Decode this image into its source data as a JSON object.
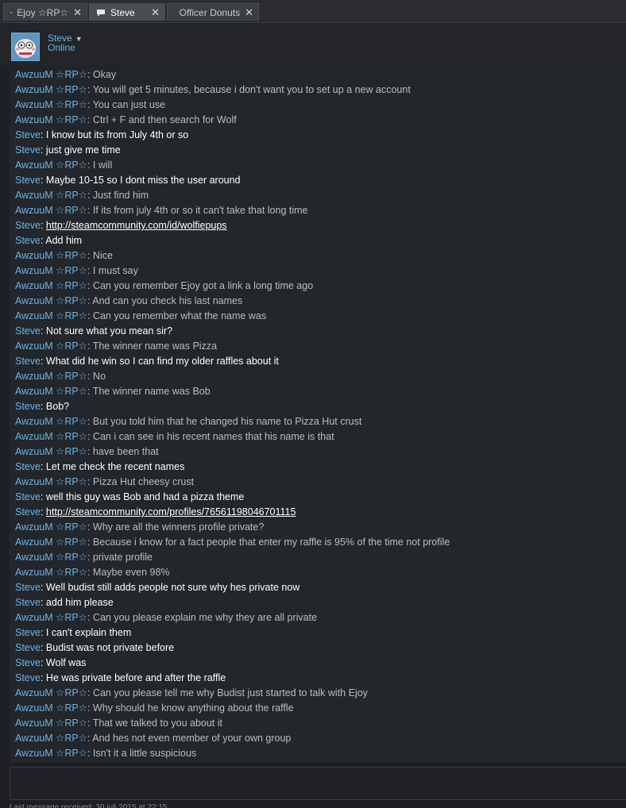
{
  "tabs": [
    {
      "label": "Ejoy ☆RP☆",
      "close": "✕"
    },
    {
      "label": "Steve",
      "close": "✕"
    },
    {
      "label": "Officer Donuts",
      "close": "✕"
    }
  ],
  "friend": {
    "name": "Steve",
    "status": "Online",
    "caret": "▼"
  },
  "messages": [
    {
      "speaker": "AwzuuM ☆RP☆",
      "sep": ": ",
      "text": "Okay",
      "type": "them"
    },
    {
      "speaker": "AwzuuM ☆RP☆",
      "sep": ": ",
      "text": "You will get 5 minutes, because i don't want you to set up a new account",
      "type": "them"
    },
    {
      "speaker": "AwzuuM ☆RP☆",
      "sep": ": ",
      "text": "You can just use",
      "type": "them"
    },
    {
      "speaker": "AwzuuM ☆RP☆",
      "sep": ": ",
      "text": "Ctrl + F and then search for Wolf",
      "type": "them"
    },
    {
      "speaker": "Steve",
      "sep": ": ",
      "text": "I know but its from July 4th or so",
      "type": "me"
    },
    {
      "speaker": "Steve",
      "sep": ": ",
      "text": "just give me time",
      "type": "me"
    },
    {
      "speaker": "AwzuuM ☆RP☆",
      "sep": ": ",
      "text": "I will",
      "type": "them"
    },
    {
      "speaker": "Steve",
      "sep": ": ",
      "text": "Maybe 10-15 so I dont miss the user around",
      "type": "me"
    },
    {
      "speaker": "AwzuuM ☆RP☆",
      "sep": ": ",
      "text": "Just find him",
      "type": "them"
    },
    {
      "speaker": "AwzuuM ☆RP☆",
      "sep": ": ",
      "text": "If its from july 4th or so it can't take that long time",
      "type": "them"
    },
    {
      "speaker": "Steve",
      "sep": ": ",
      "text": "http://steamcommunity.com/id/wolfiepups",
      "type": "me",
      "link": true
    },
    {
      "speaker": "Steve",
      "sep": ": ",
      "text": "Add him",
      "type": "me"
    },
    {
      "speaker": "AwzuuM ☆RP☆",
      "sep": ": ",
      "text": "Nice",
      "type": "them"
    },
    {
      "speaker": "AwzuuM ☆RP☆",
      "sep": ": ",
      "text": "I must say",
      "type": "them"
    },
    {
      "speaker": "AwzuuM ☆RP☆",
      "sep": ": ",
      "text": "Can you remember Ejoy got a link a long time ago",
      "type": "them"
    },
    {
      "speaker": "AwzuuM ☆RP☆",
      "sep": ": ",
      "text": "And can you check his last names",
      "type": "them"
    },
    {
      "speaker": "AwzuuM ☆RP☆",
      "sep": ": ",
      "text": "Can you remember what the name was",
      "type": "them"
    },
    {
      "speaker": "Steve",
      "sep": ": ",
      "text": "Not sure what you mean sir?",
      "type": "me"
    },
    {
      "speaker": "AwzuuM ☆RP☆",
      "sep": ": ",
      "text": "The winner name was Pizza",
      "type": "them"
    },
    {
      "speaker": "Steve",
      "sep": ": ",
      "text": "What did he win so I can find my older raffles about it",
      "type": "me"
    },
    {
      "speaker": "AwzuuM ☆RP☆",
      "sep": ": ",
      "text": "No",
      "type": "them"
    },
    {
      "speaker": "AwzuuM ☆RP☆",
      "sep": ": ",
      "text": "The winner name was Bob",
      "type": "them"
    },
    {
      "speaker": "Steve",
      "sep": ": ",
      "text": "Bob?",
      "type": "me"
    },
    {
      "speaker": "AwzuuM ☆RP☆",
      "sep": ": ",
      "text": "But you told him that he changed his name to Pizza Hut crust",
      "type": "them"
    },
    {
      "speaker": "AwzuuM ☆RP☆",
      "sep": ": ",
      "text": "Can i can see in his recent names that his name is that",
      "type": "them"
    },
    {
      "speaker": "AwzuuM ☆RP☆",
      "sep": ": ",
      "text": "have been that",
      "type": "them"
    },
    {
      "speaker": "Steve",
      "sep": ": ",
      "text": "Let me check the recent names",
      "type": "me"
    },
    {
      "speaker": "AwzuuM ☆RP☆",
      "sep": ": ",
      "text": "Pizza Hut cheesy crust",
      "type": "them"
    },
    {
      "speaker": "Steve",
      "sep": ": ",
      "text": "well this guy was Bob and had a pizza theme",
      "type": "me"
    },
    {
      "speaker": "Steve",
      "sep": ": ",
      "text": "http://steamcommunity.com/profiles/76561198046701115",
      "type": "me",
      "link": true
    },
    {
      "speaker": "AwzuuM ☆RP☆",
      "sep": ": ",
      "text": "Why are all the winners profile private?",
      "type": "them"
    },
    {
      "speaker": "AwzuuM ☆RP☆",
      "sep": ": ",
      "text": "Because i know for a fact people that enter my raffle is 95% of the time not profile",
      "type": "them"
    },
    {
      "speaker": "AwzuuM ☆RP☆",
      "sep": ": ",
      "text": "private profile",
      "type": "them"
    },
    {
      "speaker": "AwzuuM ☆RP☆",
      "sep": ": ",
      "text": "Maybe even 98%",
      "type": "them"
    },
    {
      "speaker": "Steve",
      "sep": ": ",
      "text": "Well budist still adds people not sure why hes private now",
      "type": "me"
    },
    {
      "speaker": "Steve",
      "sep": ": ",
      "text": "add him please",
      "type": "me"
    },
    {
      "speaker": "AwzuuM ☆RP☆",
      "sep": ": ",
      "text": "Can you please explain me why they are all private",
      "type": "them"
    },
    {
      "speaker": "Steve",
      "sep": ": ",
      "text": "I can't explain them",
      "type": "me"
    },
    {
      "speaker": "Steve",
      "sep": ": ",
      "text": "Budist was not private before",
      "type": "me"
    },
    {
      "speaker": "Steve",
      "sep": ": ",
      "text": "Wolf was",
      "type": "me"
    },
    {
      "speaker": "Steve",
      "sep": ": ",
      "text": "He was private before and after the raffle",
      "type": "me"
    },
    {
      "speaker": "AwzuuM ☆RP☆",
      "sep": ": ",
      "text": "Can you please tell me why Budist just started to talk with Ejoy",
      "type": "them"
    },
    {
      "speaker": "AwzuuM ☆RP☆",
      "sep": ": ",
      "text": "Why should he know anything about the raffle",
      "type": "them"
    },
    {
      "speaker": "AwzuuM ☆RP☆",
      "sep": ": ",
      "text": "That we talked to you about it",
      "type": "them"
    },
    {
      "speaker": "AwzuuM ☆RP☆",
      "sep": ": ",
      "text": "And hes not even member of your own group",
      "type": "them"
    },
    {
      "speaker": "AwzuuM ☆RP☆",
      "sep": ": ",
      "text": "Isn't it a little suspicious",
      "type": "them"
    }
  ],
  "footer": {
    "text": "Last message received: 30 juli 2015 at 22:15"
  }
}
